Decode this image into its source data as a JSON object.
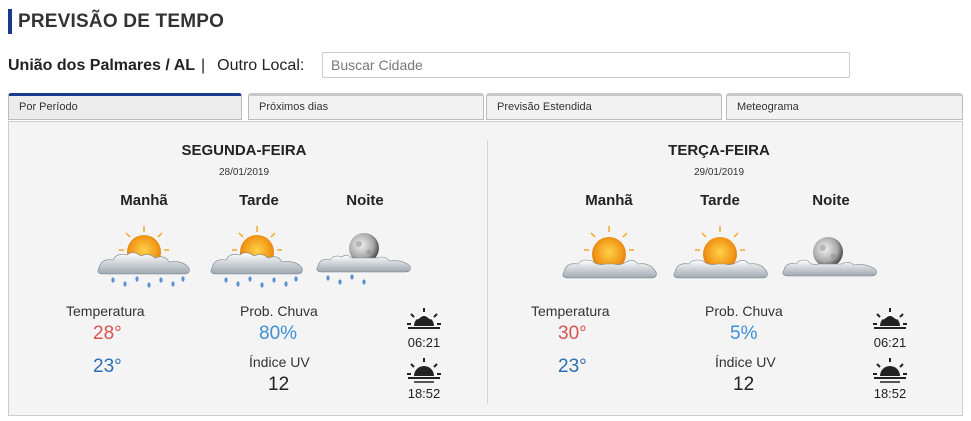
{
  "header": {
    "title": "PREVISÃO DE TEMPO"
  },
  "location": {
    "city": "União dos Palmares / AL",
    "separator": "|",
    "other_label": "Outro Local:",
    "search_placeholder": "Buscar Cidade"
  },
  "tabs": [
    {
      "label": "Por Período",
      "active": true
    },
    {
      "label": "Próximos dias",
      "active": false
    },
    {
      "label": "Previsão Estendida",
      "active": false
    },
    {
      "label": "Meteograma",
      "active": false
    }
  ],
  "days": [
    {
      "name": "SEGUNDA-FEIRA",
      "date": "28/01/2019",
      "periods": [
        {
          "label": "Manhã",
          "icon": "sun-cloud-rain-icon"
        },
        {
          "label": "Tarde",
          "icon": "sun-cloud-rain-icon"
        },
        {
          "label": "Noite",
          "icon": "moon-cloud-rain-icon"
        }
      ],
      "temp_label": "Temperatura",
      "temp_max": "28°",
      "temp_min": "23°",
      "rain_label": "Prob. Chuva",
      "rain_value": "80%",
      "uv_label": "Índice UV",
      "uv_value": "12",
      "sunrise": "06:21",
      "sunset": "18:52"
    },
    {
      "name": "TERÇA-FEIRA",
      "date": "29/01/2019",
      "periods": [
        {
          "label": "Manhã",
          "icon": "sun-cloud-icon"
        },
        {
          "label": "Tarde",
          "icon": "sun-cloud-icon"
        },
        {
          "label": "Noite",
          "icon": "moon-cloud-icon"
        }
      ],
      "temp_label": "Temperatura",
      "temp_max": "30°",
      "temp_min": "23°",
      "rain_label": "Prob. Chuva",
      "rain_value": "5%",
      "uv_label": "Índice UV",
      "uv_value": "12",
      "sunrise": "06:21",
      "sunset": "18:52"
    }
  ],
  "colors": {
    "accent": "#1a3a8c",
    "temp_max": "#d9534f",
    "temp_min": "#2c6fb6",
    "rain": "#3d8fd6"
  }
}
